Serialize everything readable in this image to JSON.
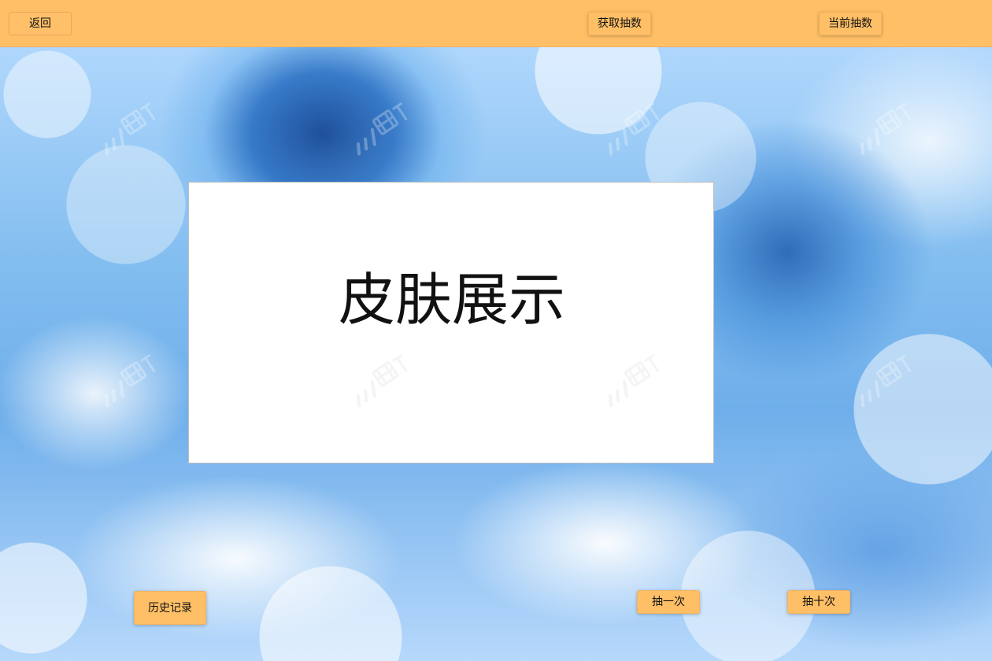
{
  "header": {
    "back_label": "返回",
    "get_draws_label": "获取抽数",
    "current_draws_label": "当前抽数"
  },
  "main": {
    "skin_display_title": "皮肤展示"
  },
  "footer": {
    "history_label": "历史记录",
    "draw_once_label": "抽一次",
    "draw_ten_label": "抽十次"
  },
  "colors": {
    "accent": "#ffbf66",
    "panel_background": "#ffffff"
  },
  "icons": {
    "watermark": "watermark-icon"
  }
}
